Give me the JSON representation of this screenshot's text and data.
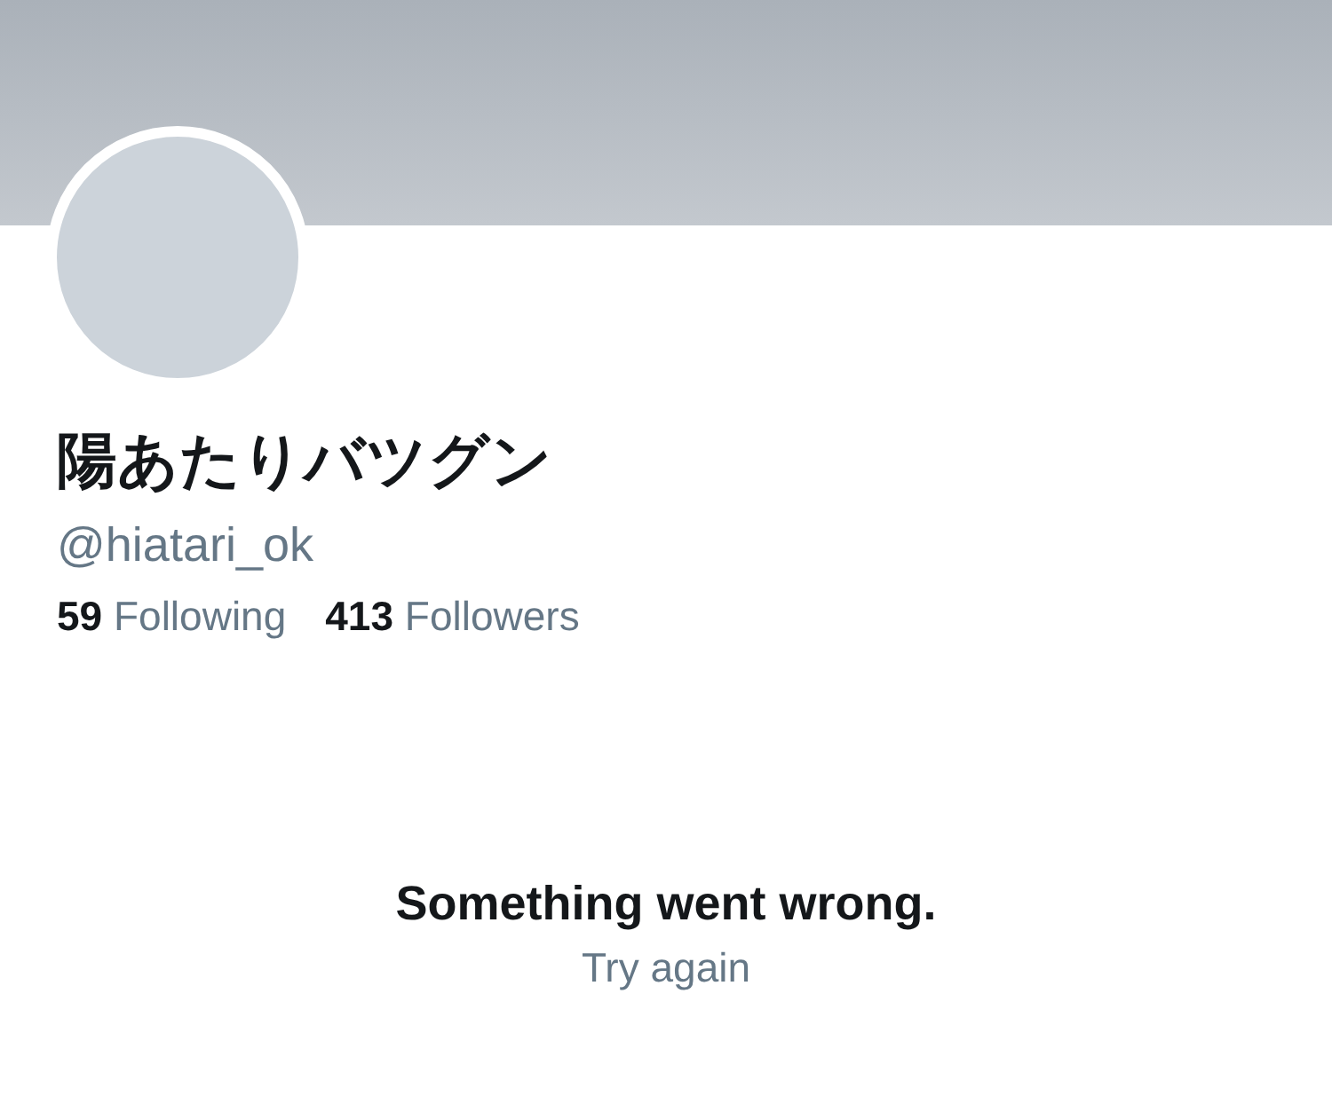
{
  "profile": {
    "name": "陽あたりバツグン",
    "handle": "@hiatari_ok",
    "stats": [
      {
        "count": "59",
        "label": "Following"
      },
      {
        "count": "413",
        "label": "Followers"
      }
    ]
  },
  "error": {
    "message": "Something went wrong.",
    "retry": "Try again"
  }
}
